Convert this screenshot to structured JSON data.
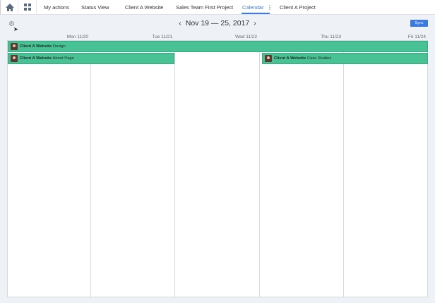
{
  "nav": {
    "tabs": [
      "My actions",
      "Status View",
      "Client A Website",
      "Sales Team First Project",
      "Calendar",
      "Client A Project"
    ],
    "active": "Calendar"
  },
  "header": {
    "title": "Nov 19 — 25, 2017",
    "prev": "‹",
    "next": "›",
    "sync_label": "Sync"
  },
  "days": [
    "Mon 11/20",
    "Tue 11/21",
    "Wed 11/22",
    "Thu 11/23",
    "Fri 11/24"
  ],
  "events": [
    {
      "project": "Client A Website",
      "task": "Design"
    },
    {
      "project": "Client A Website",
      "task": "About Page"
    },
    {
      "project": "Client A Website",
      "task": "Case Studies"
    }
  ],
  "colors": {
    "accent": "#3b7be0",
    "event": "#48c195"
  }
}
